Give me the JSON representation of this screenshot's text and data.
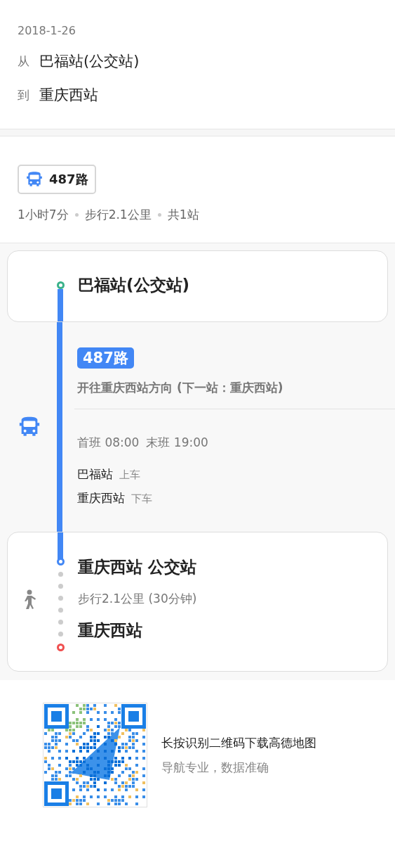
{
  "trip": {
    "date": "2018-1-26",
    "from": {
      "label": "从",
      "value": "巴福站(公交站)"
    },
    "to": {
      "label": "到",
      "value": "重庆西站"
    }
  },
  "summary": {
    "route": "487路",
    "stats": [
      "1小时7分",
      "步行2.1公里",
      "共1站"
    ]
  },
  "segments": [
    {
      "kind": "stop",
      "title": "巴福站(公交站)"
    },
    {
      "kind": "bus",
      "route": "487路",
      "direction": "开往重庆西站方向 (下一站：重庆西站)",
      "schedule": [
        "首班 08:00",
        "末班 19:00"
      ],
      "stops": [
        {
          "name": "巴福站",
          "action": "上车"
        },
        {
          "name": "重庆西站",
          "action": "下车"
        }
      ]
    },
    {
      "kind": "walk",
      "title": "重庆西站 公交站",
      "walk": "步行2.1公里 (30分钟)",
      "destination": "重庆西站"
    }
  ],
  "footer": {
    "title": "长按识别二维码下载高德地图",
    "subtitle": "导航专业，数据准确"
  }
}
